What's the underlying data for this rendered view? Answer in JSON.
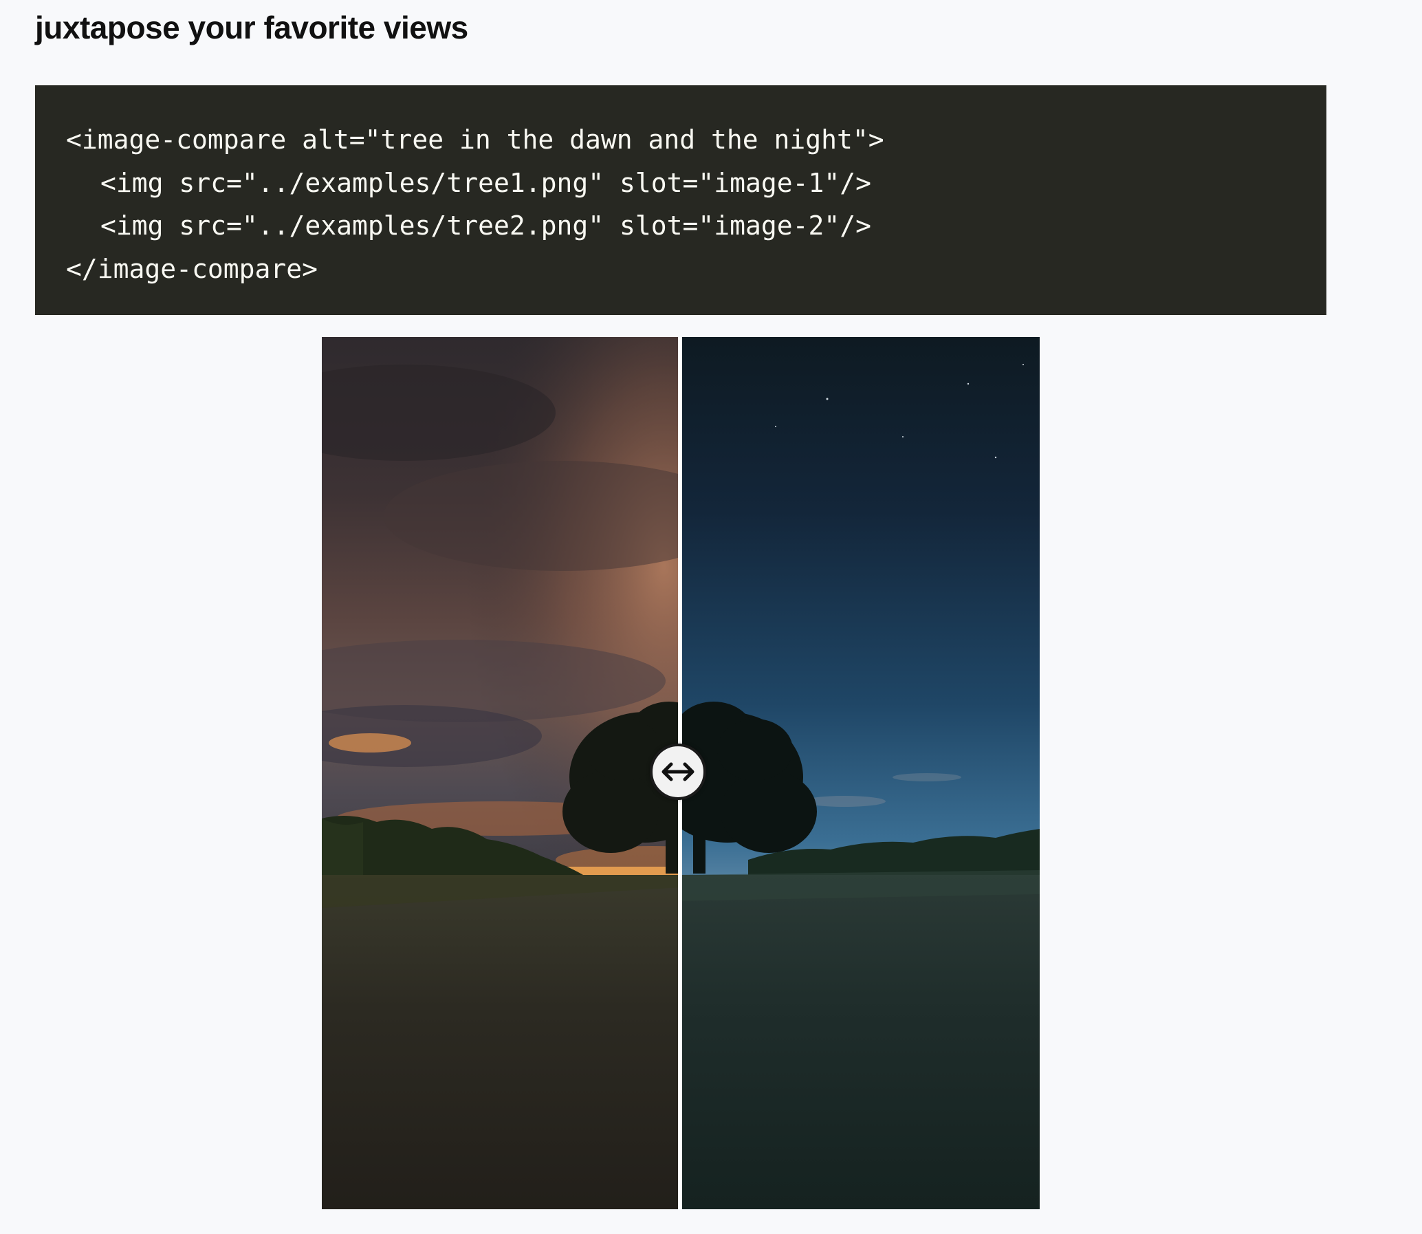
{
  "page": {
    "title": "juxtapose your favorite views"
  },
  "code_sample": {
    "lines": [
      "<image-compare alt=\"tree in the dawn and the night\">",
      "<img src=\"../examples/tree1.png\" slot=\"image-1\"/>",
      "<img src=\"../examples/tree2.png\" slot=\"image-2\"/>",
      "</image-compare>"
    ],
    "background_color": "#272822",
    "text_color": "#f8f8f2"
  },
  "image_compare": {
    "slider_position_fraction": 0.5,
    "left_image_scene": "tree at dawn with orange sunset clouds",
    "right_image_scene": "tree at night under blue starry sky",
    "handle_icon": "left-right-arrow-icon"
  }
}
